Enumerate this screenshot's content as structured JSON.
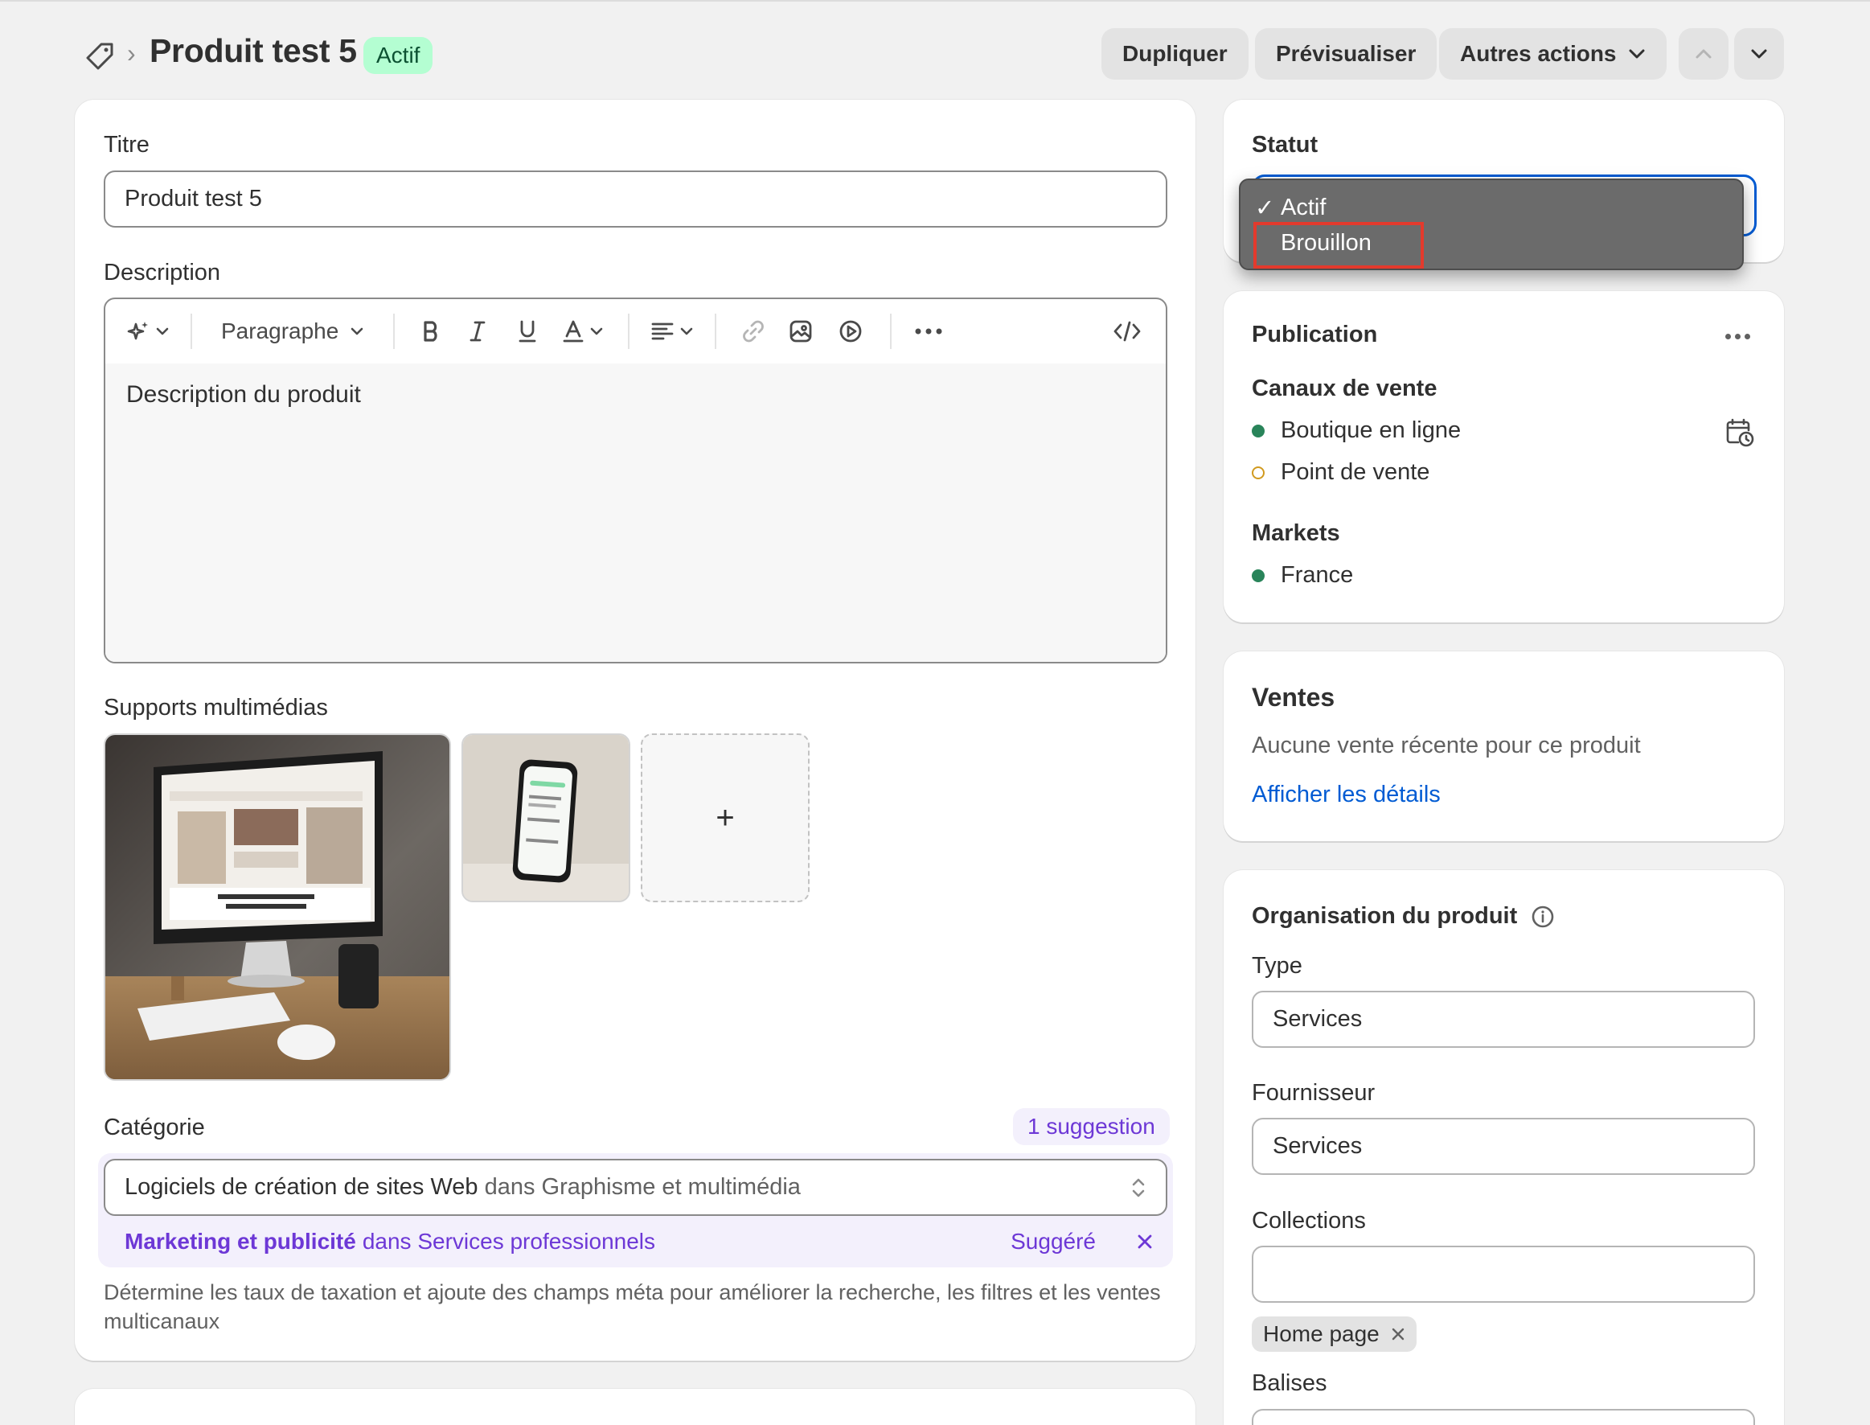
{
  "header": {
    "title": "Produit test 5",
    "status_badge": "Actif",
    "buttons": {
      "duplicate": "Dupliquer",
      "preview": "Prévisualiser",
      "more_actions": "Autres actions"
    }
  },
  "title_field": {
    "label": "Titre",
    "value": "Produit test 5"
  },
  "description": {
    "label": "Description",
    "format_select": "Paragraphe",
    "content": "Description du produit"
  },
  "media": {
    "label": "Supports multimédias",
    "add_symbol": "+"
  },
  "category": {
    "label": "Catégorie",
    "suggestion_badge": "1 suggestion",
    "value_main": "Logiciels de création de sites Web",
    "value_context": "dans Graphisme et multimédia",
    "suggested_main": "Marketing et publicité",
    "suggested_context": "dans Services professionnels",
    "suggested_tag": "Suggéré",
    "help": "Détermine les taux de taxation et ajoute des champs méta pour améliorer la recherche, les filtres et les ventes multicanaux"
  },
  "status": {
    "label": "Statut",
    "options": [
      {
        "label": "Actif",
        "checked": true
      },
      {
        "label": "Brouillon",
        "checked": false
      }
    ],
    "highlight_color": "#e33a2d"
  },
  "publication": {
    "label": "Publication",
    "channels_label": "Canaux de vente",
    "channels": [
      {
        "label": "Boutique en ligne",
        "state": "active"
      },
      {
        "label": "Point de vente",
        "state": "inactive"
      }
    ],
    "markets_label": "Markets",
    "markets": [
      {
        "label": "France",
        "state": "active"
      }
    ]
  },
  "sales": {
    "label": "Ventes",
    "empty_text": "Aucune vente récente pour ce produit",
    "link": "Afficher les détails"
  },
  "organization": {
    "label": "Organisation du produit",
    "type_label": "Type",
    "type_value": "Services",
    "vendor_label": "Fournisseur",
    "vendor_value": "Services",
    "collections_label": "Collections",
    "collections_value": "",
    "collection_chips": [
      "Home page"
    ],
    "tags_label": "Balises"
  },
  "colors": {
    "accent_blue": "#005bd3",
    "success_green": "#29845a",
    "badge_green_bg": "#b4fed2",
    "magic_purple": "#6d38d6"
  }
}
